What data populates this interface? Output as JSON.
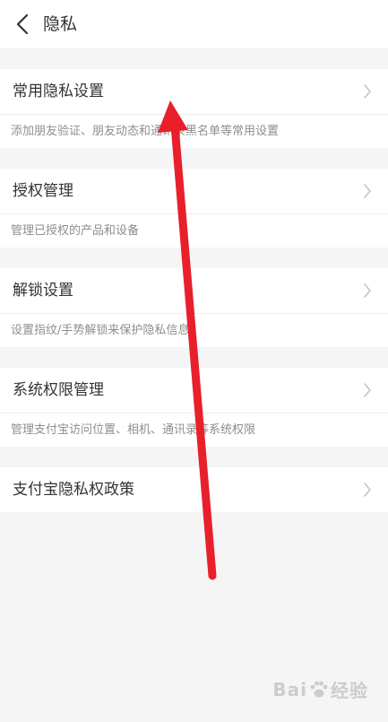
{
  "header": {
    "title": "隐私",
    "back_icon": "chevron-left-icon"
  },
  "sections": [
    {
      "label": "常用隐私设置",
      "desc": "添加朋友验证、朋友动态和通讯录黑名单等常用设置"
    },
    {
      "label": "授权管理",
      "desc": "管理已授权的产品和设备"
    },
    {
      "label": "解锁设置",
      "desc": "设置指纹/手势解锁来保护隐私信息"
    },
    {
      "label": "系统权限管理",
      "desc": "管理支付宝访问位置、相机、通讯录等系统权限"
    },
    {
      "label": "支付宝隐私权政策",
      "desc": ""
    }
  ],
  "annotation": {
    "arrow_color": "#e8202c"
  },
  "watermark": {
    "text_left": "Bai",
    "text_right": "经验",
    "icon": "paw-icon"
  },
  "colors": {
    "background": "#f5f5f5",
    "card": "#ffffff",
    "text_primary": "#333333",
    "text_secondary": "#8e8e8e",
    "chevron": "#c4c4c4"
  }
}
